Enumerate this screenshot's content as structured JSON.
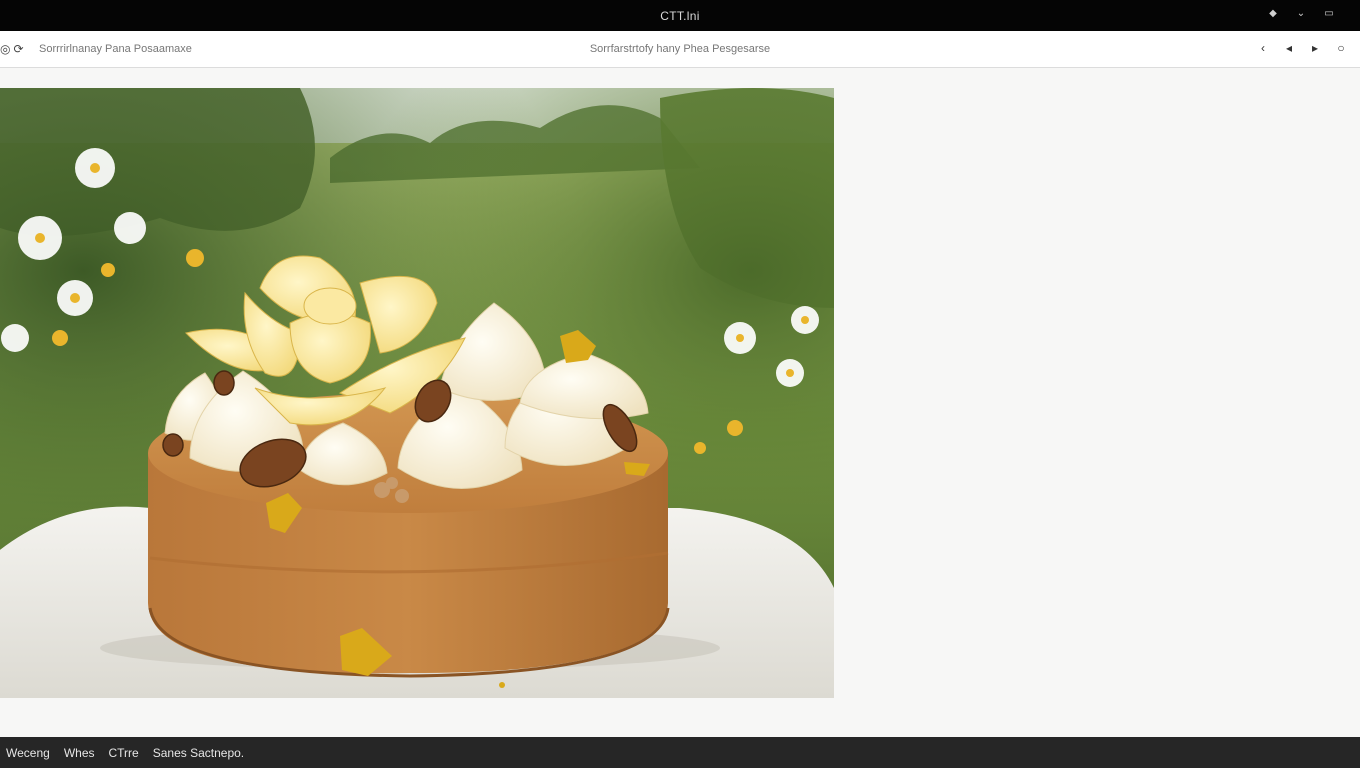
{
  "window": {
    "title": "CTT.lni",
    "controls": [
      {
        "icon": "diamond-icon",
        "glyph": "◆"
      },
      {
        "icon": "minimize-icon",
        "glyph": "⌄"
      },
      {
        "icon": "restore-icon",
        "glyph": "▭"
      }
    ]
  },
  "toolbar": {
    "left_icons": [
      {
        "icon": "eye-icon",
        "glyph": "◎"
      },
      {
        "icon": "rotate-icon",
        "glyph": "⟳"
      }
    ],
    "breadcrumb": "Sorrrirlnanay Pana Posaamaxe",
    "center_title": "Sorrfarstrtofy hany Phea Pesgesarse",
    "nav": [
      {
        "icon": "chevron-left-icon",
        "glyph": "‹"
      },
      {
        "icon": "back-icon",
        "glyph": "◂"
      },
      {
        "icon": "forward-icon",
        "glyph": "▸"
      },
      {
        "icon": "circle-icon",
        "glyph": "○"
      }
    ]
  },
  "image": {
    "subject": "caramel-cake-photo"
  },
  "statusbar": {
    "items": [
      "Weceng",
      "Whes",
      "CTrre",
      "Sanes Sactnepo."
    ]
  },
  "colors": {
    "titlebar": "#050505",
    "statusbar": "#262626",
    "page": "#f7f7f6"
  }
}
